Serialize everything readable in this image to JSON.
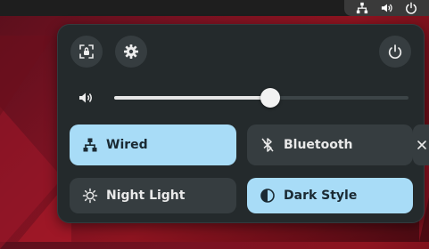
{
  "top_bar": {
    "tray_icons": [
      "network-wired-icon",
      "volume-icon",
      "power-icon"
    ]
  },
  "panel": {
    "screenshot_icon": "screenshot-icon",
    "settings_icon": "gear-icon",
    "power_icon": "power-icon",
    "volume": {
      "icon": "volume-icon",
      "level": 0.53
    },
    "tiles": [
      {
        "label": "Wired",
        "icon": "network-wired-icon",
        "active": true
      },
      {
        "label": "Bluetooth",
        "icon": "bluetooth-disabled-icon",
        "active": false
      },
      {
        "label": "Night Light",
        "icon": "night-light-icon",
        "active": false
      },
      {
        "label": "Dark Style",
        "icon": "dark-style-icon",
        "active": true
      }
    ],
    "more_arrow_icon": "chevron-right-icon"
  },
  "colors": {
    "accent_active": "#a8dcf7",
    "panel_bg": "#242a2c",
    "tile_inactive": "#363d40"
  }
}
